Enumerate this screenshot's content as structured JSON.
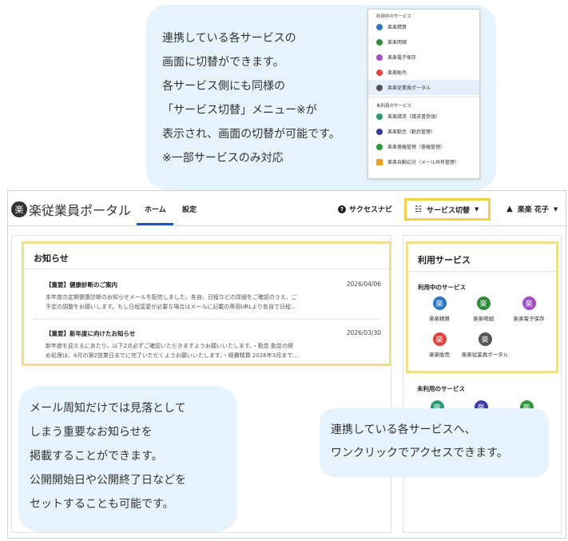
{
  "callout_top": {
    "lines": [
      "連携している各サービスの",
      "画面に切替ができます。",
      "各サービス側にも同様の",
      "「サービス切替」メニュー※が",
      "表示され、画面の切替が可能です。",
      "※一部サービスのみ対応"
    ]
  },
  "dropdown": {
    "active_header": "利用中のサービス",
    "active_items": [
      {
        "label": "楽楽精算",
        "color": "#2a78c8"
      },
      {
        "label": "楽楽明細",
        "color": "#2e8b3a"
      },
      {
        "label": "楽楽電子保存",
        "color": "#a04fc8"
      },
      {
        "label": "楽楽販売",
        "color": "#e0463c"
      },
      {
        "label": "楽楽従業員ポータル",
        "color": "#555555",
        "selected": true
      }
    ],
    "inactive_header": "未利用のサービス",
    "inactive_items": [
      {
        "label": "楽楽請求（請求書受領）",
        "color": "#2a9a78"
      },
      {
        "label": "楽楽勤怠（勤怠管理）",
        "color": "#3a3aa8"
      },
      {
        "label": "楽楽債権管理（債権管理）",
        "color": "#2e9a3a"
      },
      {
        "label": "楽楽自動応対（メール共有管理）",
        "color": "#f0a020"
      }
    ]
  },
  "app": {
    "logo_mark": "楽",
    "logo_text": "楽従業員ポータル",
    "tabs": [
      "ホーム",
      "設定"
    ],
    "success_navi": "サクセスナビ",
    "service_switch": "サービス切替",
    "user_name": "楽楽 花子",
    "news": {
      "title": "お知らせ",
      "items": [
        {
          "title": "【重要】健康診断のご案内",
          "date": "2026/04/06",
          "body_lines": [
            "本年度の定期健康診断のお知らせメールを配信しました。各自、日程などの詳細をご確認のうえ、ご",
            "予定の調整をお願いします。もし日程変更が必要な場合はメールに記載の専用URLより各自で日程…"
          ]
        },
        {
          "title": "【重要】新年度に向けたお知らせ",
          "date": "2026/03/30",
          "body_lines": [
            "新年度を迎えるにあたり、以下2点必ずご確認いただきますようお願いいたします。・勤怠 勤怠の締",
            "め処理は、4月の第2営業日までに完了いただくようお願いいたします。・経費精算 2026年3月まで…"
          ]
        }
      ]
    },
    "services": {
      "title": "利用サービス",
      "active_header": "利用中のサービス",
      "active": [
        {
          "label": "楽楽精算",
          "color": "#2a78c8"
        },
        {
          "label": "楽楽明細",
          "color": "#2e8b3a"
        },
        {
          "label": "楽楽電子保存",
          "color": "#a04fc8"
        },
        {
          "label": "楽楽販売",
          "color": "#e0463c"
        },
        {
          "label": "楽楽従業員ポータル",
          "color": "#555555"
        }
      ],
      "inactive_header": "未利用のサービス",
      "inactive_colors": [
        "#2a9a78",
        "#3a3aa8",
        "#2e9a3a"
      ]
    }
  },
  "callout_left": {
    "lines": [
      "メール周知だけでは見落として",
      "しまう重要なお知らせを",
      "掲載することができます。",
      "公開開始日や公開終了日などを",
      "セットすることも可能です。"
    ]
  },
  "callout_right": {
    "lines": [
      "連携している各サービスへ、",
      "ワンクリックでアクセスできます。"
    ]
  }
}
